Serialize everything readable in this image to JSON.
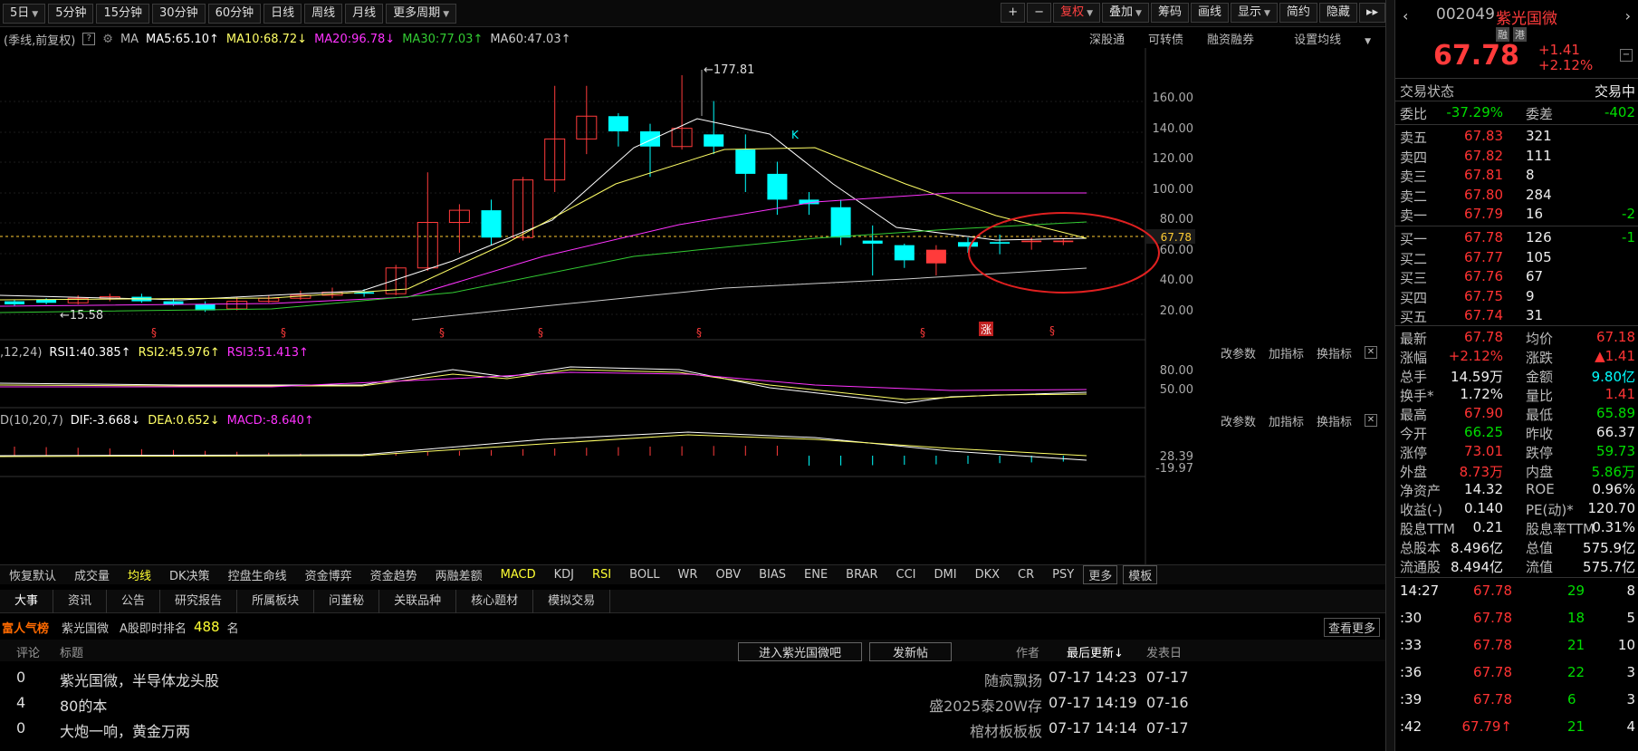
{
  "toolbar": {
    "periods": [
      "5日",
      "5分钟",
      "15分钟",
      "30分钟",
      "60分钟",
      "日线",
      "周线",
      "月线",
      "更多周期"
    ],
    "right_buttons": [
      "复权",
      "叠加",
      "筹码",
      "画线",
      "显示",
      "简约",
      "隐藏"
    ],
    "plus": "+",
    "minus": "−",
    "fwd": "▸▸"
  },
  "ma_bar": {
    "prefix": "(季线,前复权)",
    "help": "?",
    "ma_label": "MA",
    "ma5": "MA5:65.10↑",
    "ma10": "MA10:68.72↓",
    "ma20": "MA20:96.78↓",
    "ma30": "MA30:77.03↑",
    "ma60": "MA60:47.03↑",
    "links": [
      "深股通",
      "可转债",
      "融资融券",
      "设置均线"
    ]
  },
  "main_chart": {
    "high_label": "177.81",
    "low_label": "15.58",
    "k_label": "K",
    "current_price_label": "67.78",
    "y_ticks": [
      "160.00",
      "140.00",
      "120.00",
      "100.00",
      "80.00",
      "60.00",
      "40.00",
      "20.00"
    ],
    "badges": [
      "涨"
    ]
  },
  "rsi": {
    "name": ",12,24)",
    "rsi1": "RSI1:40.385↑",
    "rsi2": "RSI2:45.976↑",
    "rsi3": "RSI3:51.413↑",
    "ticks": [
      "80.00",
      "50.00"
    ]
  },
  "macd": {
    "name": "D(10,20,7)",
    "dif": "DIF:-3.668↓",
    "dea": "DEA:0.652↓",
    "macd": "MACD:-8.640↑",
    "ticks": [
      "28.39",
      "-19.97"
    ]
  },
  "panel_tools": [
    "改参数",
    "加指标",
    "换指标"
  ],
  "close_x": "✕",
  "indicator_tabs": [
    "恢复默认",
    "成交量",
    "均线",
    "DK决策",
    "控盘生命线",
    "资金博弈",
    "资金趋势",
    "两融差额",
    "MACD",
    "KDJ",
    "RSI",
    "BOLL",
    "WR",
    "OBV",
    "BIAS",
    "ENE",
    "BRAR",
    "CCI",
    "DMI",
    "DKX",
    "CR",
    "PSY",
    "更多",
    "模板"
  ],
  "news_tabs": [
    "大事",
    "资讯",
    "公告",
    "研究报告",
    "所属板块",
    "问董秘",
    "关联品种",
    "核心题材",
    "模拟交易"
  ],
  "rank": {
    "title": "富人气榜",
    "name": "紫光国微",
    "label": "A股即时排名",
    "value": "488",
    "unit": "名",
    "more": "查看更多"
  },
  "news_header": {
    "c1": "评论",
    "c2": "标题",
    "btn1": "进入紫光国微吧",
    "btn2": "发新帖",
    "c3": "作者",
    "c4": "最后更新↓",
    "c5": "发表日"
  },
  "news": [
    {
      "count": "0",
      "title": "紫光国微，半导体龙头股",
      "author": "随疯飘扬",
      "updated": "07-17 14:23",
      "date": "07-17"
    },
    {
      "count": "4",
      "title": "80的本",
      "author": "盛2025泰20W存",
      "updated": "07-17 14:19",
      "date": "07-16"
    },
    {
      "count": "0",
      "title": "大炮一响，黄金万两",
      "author": "棺材板板板",
      "updated": "07-17 14:14",
      "date": "07-17"
    }
  ],
  "quote": {
    "code": "002049",
    "name": "紫光国微",
    "tag1": "融",
    "tag2": "港",
    "price": "67.78",
    "change": "+1.41",
    "change_pct": "+2.12%",
    "status_label": "交易状态",
    "status": "交易中",
    "webi_label": "委比",
    "webi": "-37.29%",
    "weicha_label": "委差",
    "weicha": "-402"
  },
  "asks": [
    {
      "label": "卖五",
      "price": "67.83",
      "vol": "321",
      "chg": ""
    },
    {
      "label": "卖四",
      "price": "67.82",
      "vol": "111",
      "chg": ""
    },
    {
      "label": "卖三",
      "price": "67.81",
      "vol": "8",
      "chg": ""
    },
    {
      "label": "卖二",
      "price": "67.80",
      "vol": "284",
      "chg": ""
    },
    {
      "label": "卖一",
      "price": "67.79",
      "vol": "16",
      "chg": "-2"
    }
  ],
  "bids": [
    {
      "label": "买一",
      "price": "67.78",
      "vol": "126",
      "chg": "-1"
    },
    {
      "label": "买二",
      "price": "67.77",
      "vol": "105",
      "chg": ""
    },
    {
      "label": "买三",
      "price": "67.76",
      "vol": "67",
      "chg": ""
    },
    {
      "label": "买四",
      "price": "67.75",
      "vol": "9",
      "chg": ""
    },
    {
      "label": "买五",
      "price": "67.74",
      "vol": "31",
      "chg": ""
    }
  ],
  "stats": [
    {
      "l1": "最新",
      "v1": "67.78",
      "c1": "red",
      "l2": "均价",
      "v2": "67.18",
      "c2": "red"
    },
    {
      "l1": "涨幅",
      "v1": "+2.12%",
      "c1": "red",
      "l2": "涨跌",
      "v2": "▲1.41",
      "c2": "red"
    },
    {
      "l1": "总手",
      "v1": "14.59万",
      "c1": "white",
      "l2": "金额",
      "v2": "9.80亿",
      "c2": "cyan"
    },
    {
      "l1": "换手*",
      "v1": "1.72%",
      "c1": "white",
      "l2": "量比",
      "v2": "1.41",
      "c2": "red"
    },
    {
      "l1": "最高",
      "v1": "67.90",
      "c1": "red",
      "l2": "最低",
      "v2": "65.89",
      "c2": "green"
    },
    {
      "l1": "今开",
      "v1": "66.25",
      "c1": "green",
      "l2": "昨收",
      "v2": "66.37",
      "c2": "white"
    },
    {
      "l1": "涨停",
      "v1": "73.01",
      "c1": "red",
      "l2": "跌停",
      "v2": "59.73",
      "c2": "green"
    },
    {
      "l1": "外盘",
      "v1": "8.73万",
      "c1": "red",
      "l2": "内盘",
      "v2": "5.86万",
      "c2": "green"
    },
    {
      "l1": "净资产",
      "v1": "14.32",
      "c1": "white",
      "l2": "ROE",
      "v2": "0.96%",
      "c2": "white"
    },
    {
      "l1": "收益(-)",
      "v1": "0.140",
      "c1": "white",
      "l2": "PE(动)*",
      "v2": "120.70",
      "c2": "white"
    },
    {
      "l1": "股息TTM",
      "v1": "0.21",
      "c1": "white",
      "l2": "股息率TTM",
      "v2": "0.31%",
      "c2": "white"
    },
    {
      "l1": "总股本",
      "v1": "8.496亿",
      "c1": "white",
      "l2": "总值",
      "v2": "575.9亿",
      "c2": "white"
    },
    {
      "l1": "流通股",
      "v1": "8.494亿",
      "c1": "white",
      "l2": "流值",
      "v2": "575.7亿",
      "c2": "white"
    }
  ],
  "ticks": [
    {
      "time": "14:27",
      "price": "67.78",
      "vol": "29",
      "n": "8"
    },
    {
      "time": ":30",
      "price": "67.78",
      "vol": "18",
      "n": "5"
    },
    {
      "time": ":33",
      "price": "67.78",
      "vol": "21",
      "n": "10"
    },
    {
      "time": ":36",
      "price": "67.78",
      "vol": "22",
      "n": "3"
    },
    {
      "time": ":39",
      "price": "67.78",
      "vol": "6",
      "n": "3"
    },
    {
      "time": ":42",
      "price": "67.79↑",
      "vol": "21",
      "n": "4"
    }
  ],
  "colors": {
    "up": "#ff3b3b",
    "down": "#00ffff",
    "ma5": "#ffffff",
    "ma10": "#ffff66",
    "ma20": "#ff33ff",
    "ma30": "#33cc33",
    "ma60": "#cccccc",
    "accent": "#ff4040"
  }
}
